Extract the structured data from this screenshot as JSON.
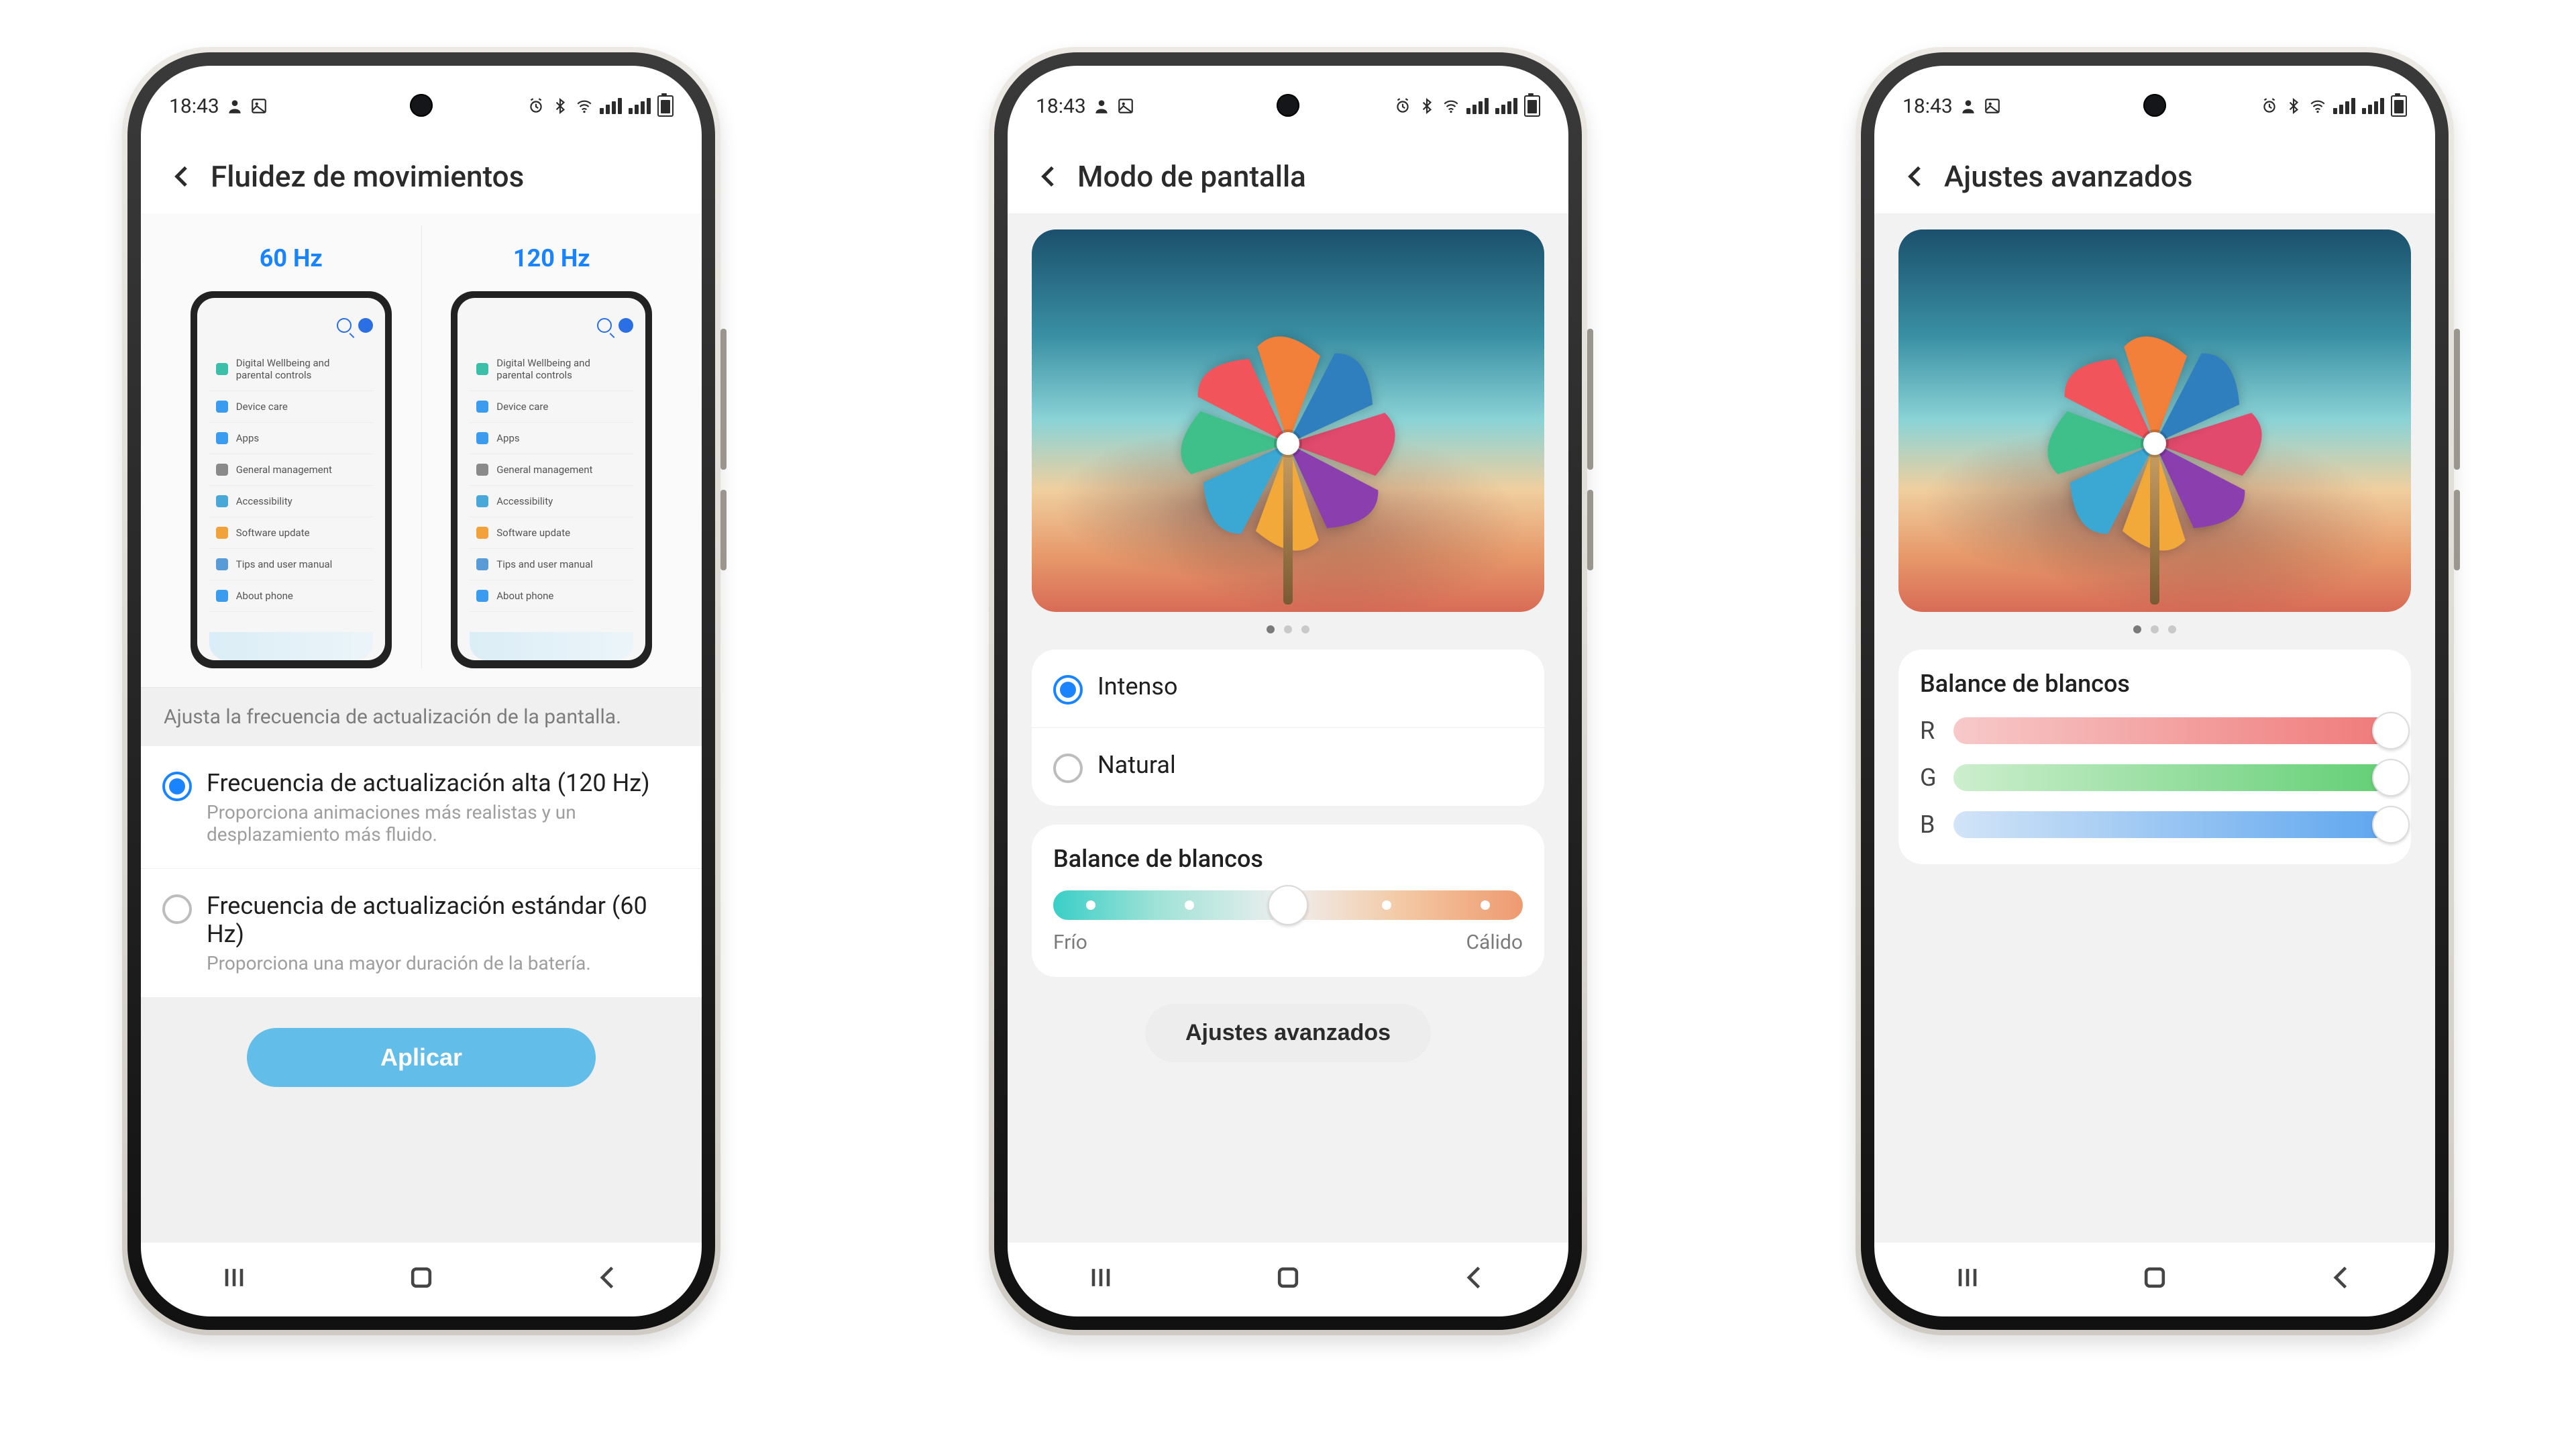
{
  "status": {
    "time": "18:43"
  },
  "phone1": {
    "title": "Fluidez de movimientos",
    "hz60": "60 Hz",
    "hz120": "120 Hz",
    "mini_items": [
      "Digital Wellbeing and parental controls",
      "Device care",
      "Apps",
      "General management",
      "Accessibility",
      "Software update",
      "Tips and user manual",
      "About phone"
    ],
    "description": "Ajusta la frecuencia de actualización de la pantalla.",
    "opt120_title": "Frecuencia de actualización alta (120 Hz)",
    "opt120_desc": "Proporciona animaciones más realistas y un desplazamiento más fluido.",
    "opt60_title": "Frecuencia de actualización estándar (60 Hz)",
    "opt60_desc": "Proporciona una mayor duración de la batería.",
    "apply": "Aplicar"
  },
  "phone2": {
    "title": "Modo de pantalla",
    "opt_intense": "Intenso",
    "opt_natural": "Natural",
    "wb_title": "Balance de blancos",
    "wb_cold": "Frío",
    "wb_warm": "Cálido",
    "advanced_btn": "Ajustes avanzados"
  },
  "phone3": {
    "title": "Ajustes avanzados",
    "wb_title": "Balance de blancos",
    "r": "R",
    "g": "G",
    "b": "B"
  },
  "pinwheel_colors": [
    "#e14a6d",
    "#8b3fae",
    "#f2a93a",
    "#3ba8d4",
    "#3fbf8a",
    "#f2545b",
    "#f27f3a",
    "#2f7fbf"
  ]
}
